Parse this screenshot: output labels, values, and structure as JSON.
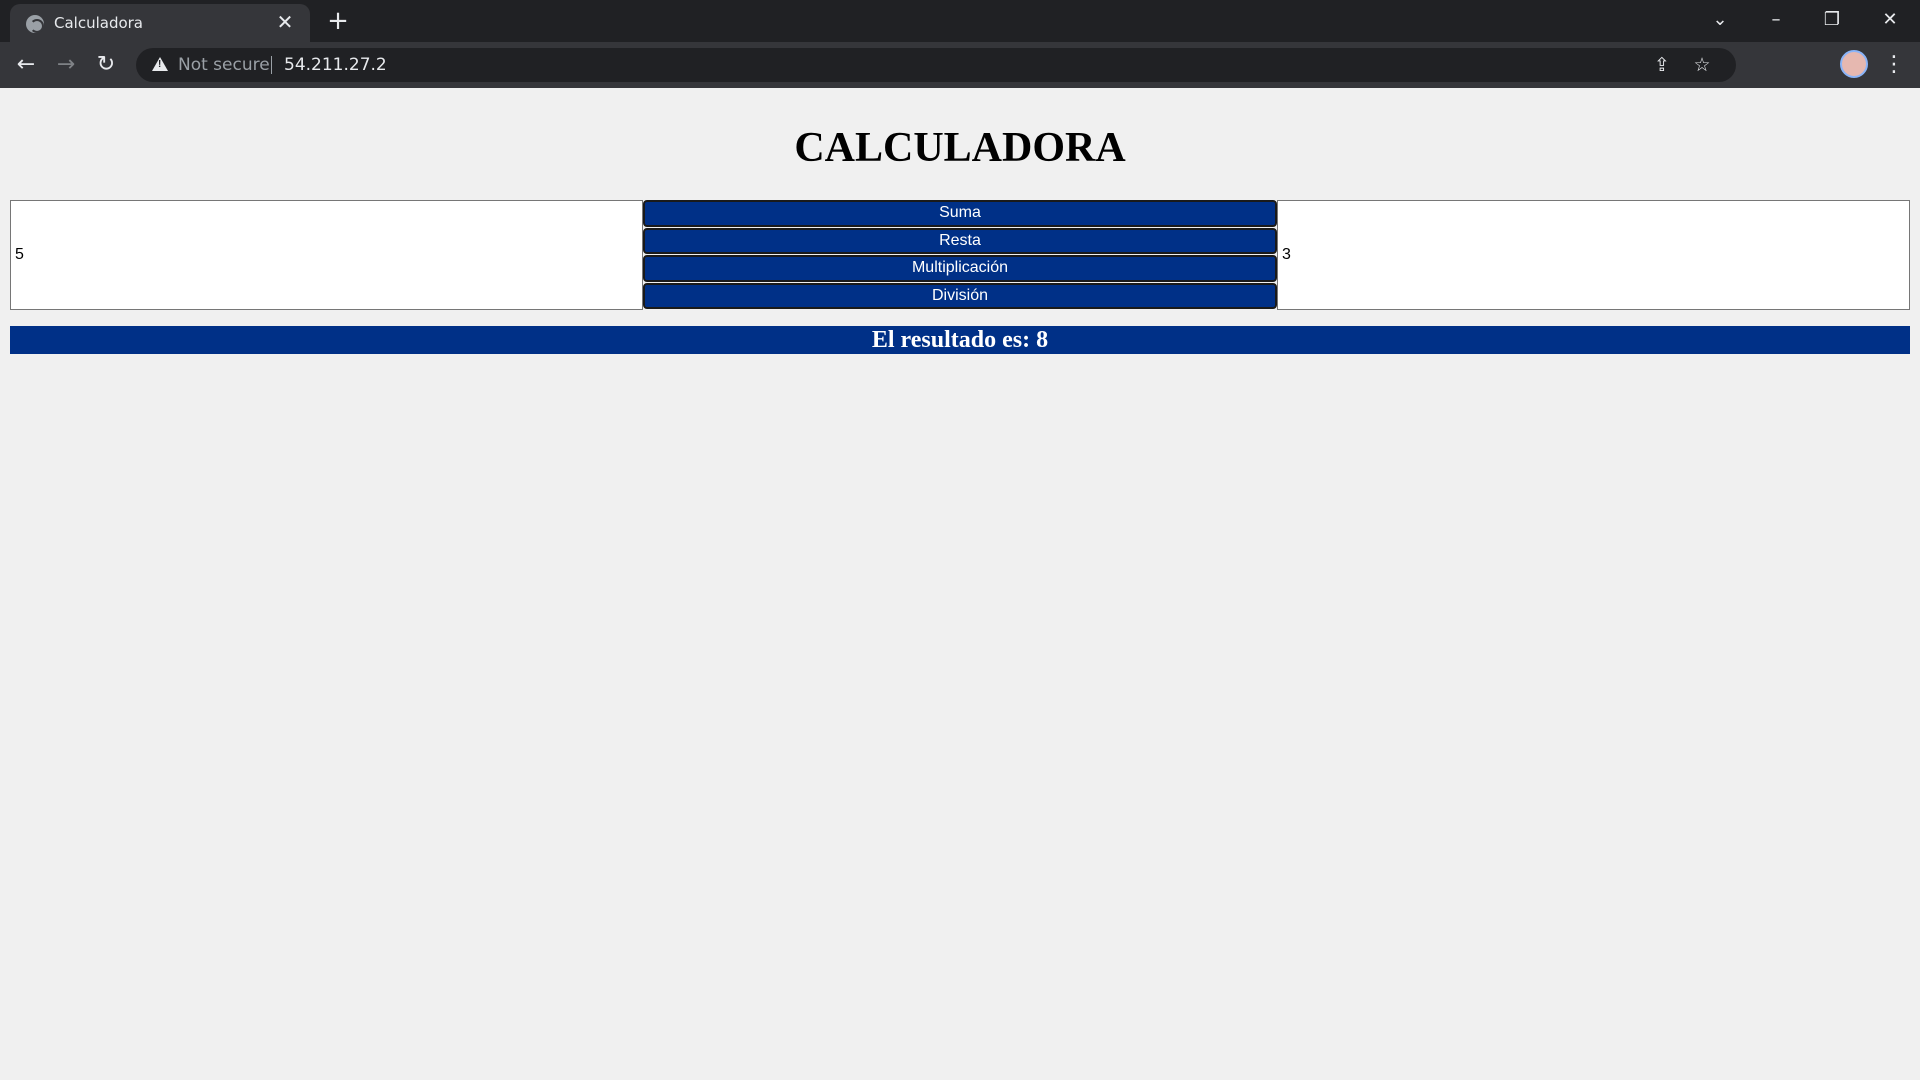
{
  "browser": {
    "tab_title": "Calculadora",
    "tab_close_glyph": "✕",
    "new_tab_glyph": "+",
    "security_label": "Not secure",
    "url": "54.211.27.2",
    "icons": {
      "back": "back-arrow-icon",
      "forward": "forward-arrow-icon",
      "reload": "reload-icon",
      "share": "share-icon",
      "bookmark": "star-icon",
      "menu": "kebab-menu-icon"
    }
  },
  "page": {
    "title": "CALCULADORA",
    "input_a": "5",
    "input_b": "3",
    "operations": [
      "Suma",
      "Resta",
      "Multiplicación",
      "División"
    ],
    "result_label": "El resultado es: ",
    "result_value": "8"
  },
  "colors": {
    "accent": "#003087",
    "page_bg": "#f0f0f0",
    "chrome_bg": "#202124",
    "toolbar_bg": "#35363a"
  }
}
